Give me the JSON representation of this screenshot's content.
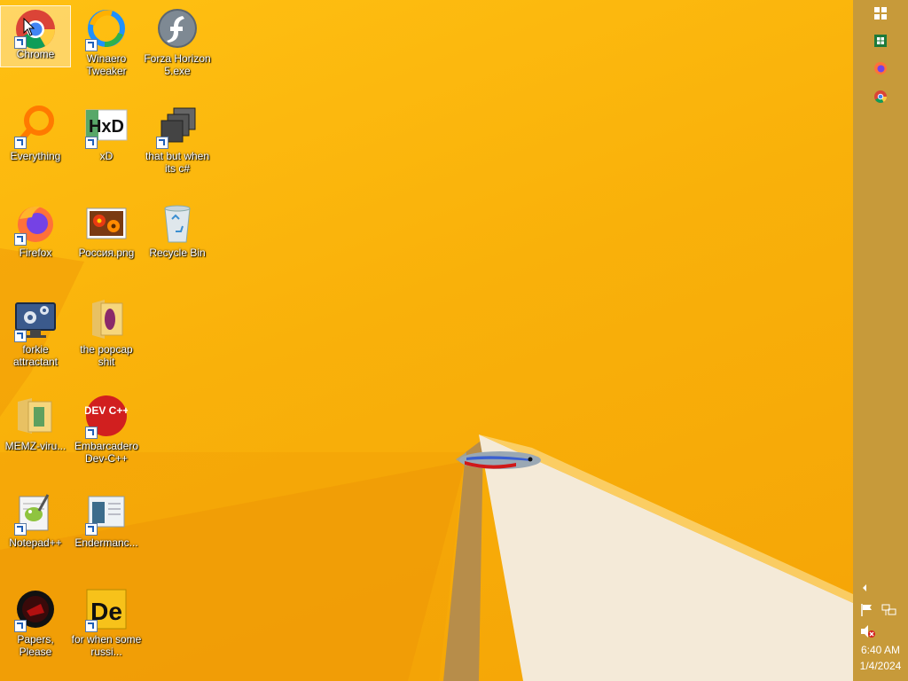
{
  "desktop": {
    "icons": [
      {
        "label": "Chrome",
        "icon": "chrome-icon",
        "selected": true
      },
      {
        "label": "Winaero Tweaker",
        "icon": "winaero-tweaker-icon"
      },
      {
        "label": "Forza Horizon 5.exe",
        "icon": "flash-icon"
      },
      {
        "label": "Everything",
        "icon": "everything-search-icon"
      },
      {
        "label": "xD",
        "icon": "hxd-icon"
      },
      {
        "label": "that but when its c#",
        "icon": "windows-stack-icon"
      },
      {
        "label": "Firefox",
        "icon": "firefox-icon"
      },
      {
        "label": "Россия.png",
        "icon": "flower-image-icon"
      },
      {
        "label": "Recycle Bin",
        "icon": "recycle-bin-icon"
      },
      {
        "label": "forkie attractant",
        "icon": "settings-monitor-icon"
      },
      {
        "label": "the popcap shit",
        "icon": "folder-icon"
      },
      {
        "label": "MEMZ-viru...",
        "icon": "folder-icon"
      },
      {
        "label": "Embarcadero Dev-C++",
        "icon": "devcpp-icon"
      },
      {
        "label": "Notepad++",
        "icon": "notepadpp-icon"
      },
      {
        "label": "Endermanc...",
        "icon": "document-icon"
      },
      {
        "label": "Papers, Please",
        "icon": "papers-please-icon"
      },
      {
        "label": "for when some russi...",
        "icon": "de-app-icon"
      }
    ],
    "devcpp_text": "DEV C++",
    "hxd_text": "HxD",
    "de_text": "De"
  },
  "taskbar": {
    "pinned": [
      "windows-start-icon",
      "excel-icon",
      "firefox-icon",
      "chrome-icon"
    ],
    "tray": [
      "show-hidden-icons-icon",
      "action-center-flag-icon",
      "network-icon",
      "volume-muted-icon"
    ],
    "time": "6:40 AM",
    "date": "1/4/2024"
  },
  "colors": {
    "wallpaper": "#f9b10a",
    "taskbar": "#c79a3a"
  }
}
